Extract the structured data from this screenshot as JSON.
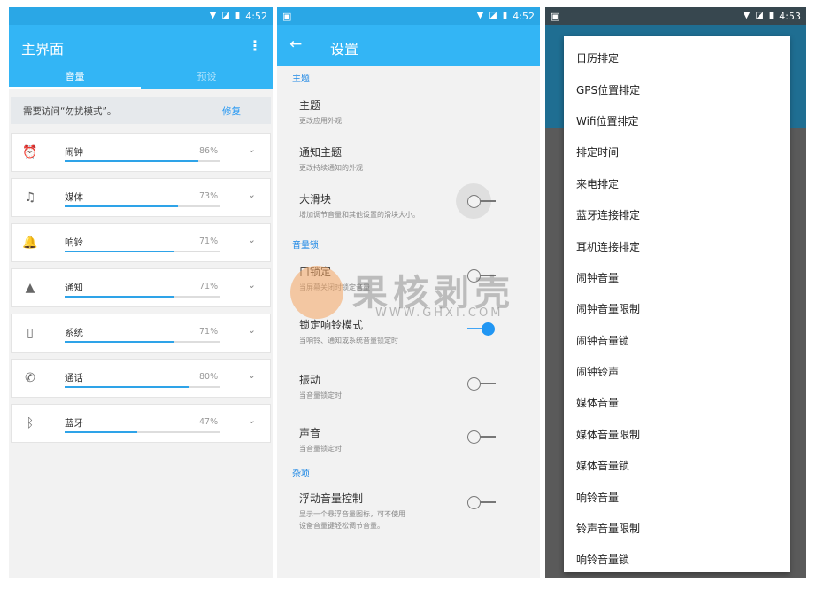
{
  "screen1": {
    "status_time": "4:52",
    "title": "主界面",
    "tabs": [
      {
        "label": "音量"
      },
      {
        "label": "预设"
      }
    ],
    "notice": {
      "text": "需要访问“勿扰模式”。",
      "action": "修复"
    },
    "volumes": [
      {
        "name": "闹钟",
        "percent": "86%",
        "level": 0.86,
        "icon": "alarm-clock-icon"
      },
      {
        "name": "媒体",
        "percent": "73%",
        "level": 0.73,
        "icon": "music-note-icon"
      },
      {
        "name": "响铃",
        "percent": "71%",
        "level": 0.71,
        "icon": "bell-icon"
      },
      {
        "name": "通知",
        "percent": "71%",
        "level": 0.71,
        "icon": "warning-icon"
      },
      {
        "name": "系统",
        "percent": "71%",
        "level": 0.71,
        "icon": "phone-device-icon"
      },
      {
        "name": "通话",
        "percent": "80%",
        "level": 0.8,
        "icon": "phone-call-icon"
      },
      {
        "name": "蓝牙",
        "percent": "47%",
        "level": 0.47,
        "icon": "bluetooth-icon"
      }
    ]
  },
  "screen2": {
    "status_time": "4:52",
    "title": "设置",
    "sections": {
      "theme": "主题",
      "volume_lock": "音量锁",
      "misc": "杂项"
    },
    "prefs": {
      "theme": {
        "title": "主题",
        "sub": "更改应用外观"
      },
      "notif_theme": {
        "title": "通知主题",
        "sub": "更改持续通知的外观"
      },
      "big_slider": {
        "title": "大滑块",
        "sub": "增加调节音量和其他设置的滑块大小。",
        "on": false
      },
      "lock_vol": {
        "title": "口锁定",
        "sub": "当屏幕关闭时锁定音量",
        "on": false
      },
      "lock_ring": {
        "title": "锁定响铃模式",
        "sub": "当响铃、通知或系统音量锁定时",
        "on": true
      },
      "vibrate": {
        "title": "振动",
        "sub": "当音量锁定时",
        "on": false
      },
      "sound": {
        "title": "声音",
        "sub": "当音量锁定时",
        "on": false
      },
      "float": {
        "title": "浮动音量控制",
        "sub": "显示一个悬浮音量图标，可不使用",
        "sub2": "设备音量键轻松调节音量。",
        "on": false
      }
    },
    "watermark": {
      "text": "果核剥壳",
      "url": "WWW.GHXI.COM"
    }
  },
  "screen3": {
    "status_time": "4:53",
    "menu": [
      "日历排定",
      "GPS位置排定",
      "Wifi位置排定",
      "排定时间",
      "来电排定",
      "蓝牙连接排定",
      "耳机连接排定",
      "闹钟音量",
      "闹钟音量限制",
      "闹钟音量锁",
      "闹钟铃声",
      "媒体音量",
      "媒体音量限制",
      "媒体音量锁",
      "响铃音量",
      "铃声音量限制",
      "响铃音量锁"
    ]
  },
  "colors": {
    "primary": "#33b5f5",
    "accent": "#2196f3"
  }
}
